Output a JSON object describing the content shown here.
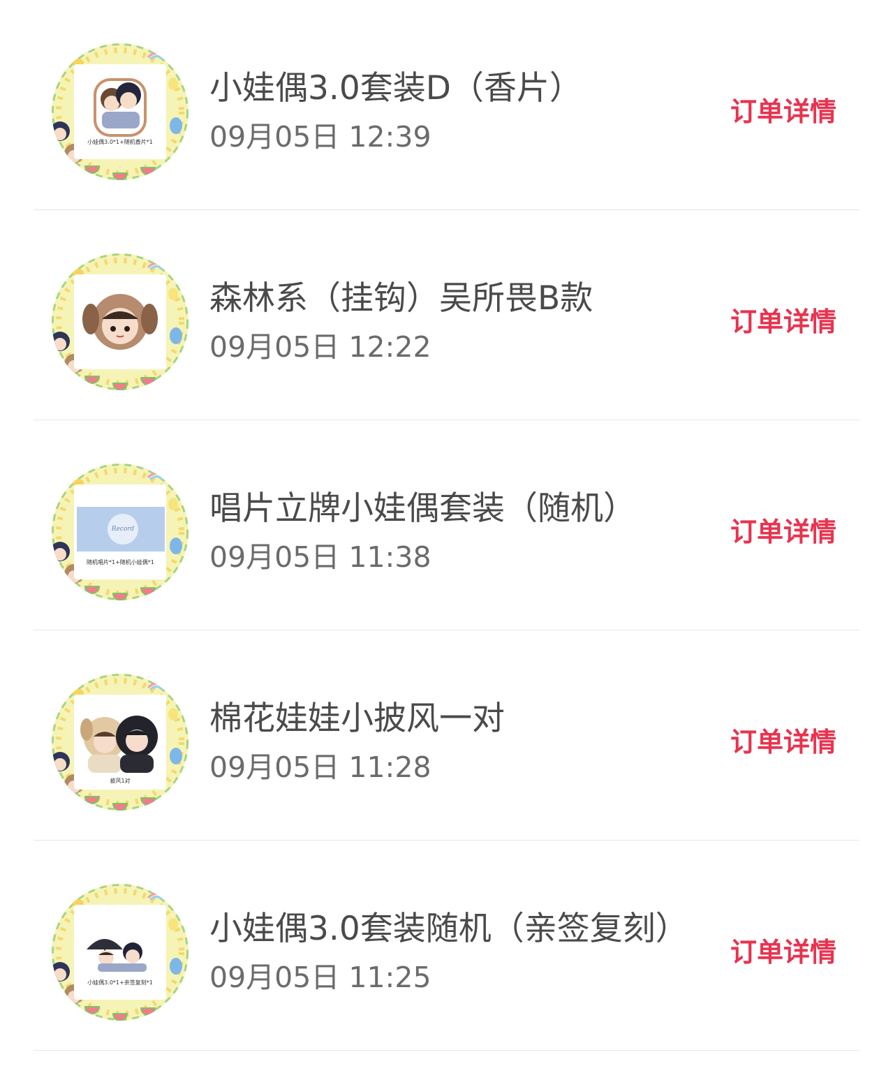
{
  "orders": [
    {
      "title": "小娃偶3.0套装D（香片）",
      "time": "09月05日 12:39",
      "detail_label": "订单详情",
      "thumb_caption": "小娃偶3.0*1+随机香片*1",
      "thumb_kind": "two-dolls-hug"
    },
    {
      "title": "森林系（挂钩）吴所畏B款",
      "time": "09月05日 12:22",
      "detail_label": "订单详情",
      "thumb_caption": "",
      "thumb_kind": "puppy-hood-doll"
    },
    {
      "title": "唱片立牌小娃偶套装（随机）",
      "time": "09月05日 11:38",
      "detail_label": "订单详情",
      "thumb_caption": "随机唱片*1+随机小娃偶*1",
      "thumb_kind": "record-card"
    },
    {
      "title": "棉花娃娃小披风一对",
      "time": "09月05日 11:28",
      "detail_label": "订单详情",
      "thumb_caption": "披风1对",
      "thumb_kind": "two-cape-dolls"
    },
    {
      "title": "小娃偶3.0套装随机（亲签复刻）",
      "time": "09月05日 11:25",
      "detail_label": "订单详情",
      "thumb_caption": "小娃偶3.0*1+亲签复刻*1",
      "thumb_kind": "umbrella-dolls"
    }
  ],
  "colors": {
    "accent": "#e8334f",
    "title": "#4a4a4a",
    "time": "#6b6b6b",
    "divider": "#e6e6e6",
    "frame_yellow": "#f3f0a8",
    "frame_green": "#9fd27a"
  }
}
